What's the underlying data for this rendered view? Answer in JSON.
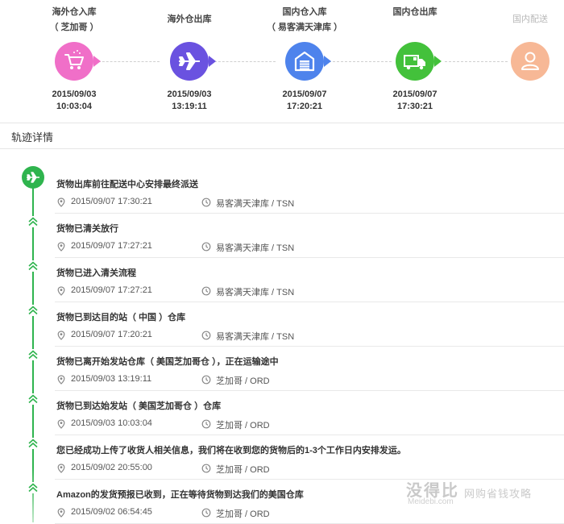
{
  "progress": {
    "steps": [
      {
        "label1": "海外仓入库",
        "label2": "（ 芝加哥 ）",
        "date": "2015/09/03",
        "time": "10:03:04",
        "color": "#f06fc8",
        "icon": "cart-icon"
      },
      {
        "label1": "海外仓出库",
        "label2": "",
        "date": "2015/09/03",
        "time": "13:19:11",
        "color": "#6a52e0",
        "icon": "airplane-icon"
      },
      {
        "label1": "国内仓入库",
        "label2": "（ 易客满天津库 ）",
        "date": "2015/09/07",
        "time": "17:20:21",
        "color": "#4e83ec",
        "icon": "warehouse-icon"
      },
      {
        "label1": "国内仓出库",
        "label2": "",
        "date": "2015/09/07",
        "time": "17:30:21",
        "color": "#43c13b",
        "icon": "truck-icon"
      },
      {
        "label1": "国内配送",
        "label2": "",
        "date": "",
        "time": "",
        "color": "#f7b896",
        "icon": "user-icon"
      }
    ]
  },
  "tracking": {
    "title": "轨迹详情",
    "accent": "#2fb44e",
    "entries": [
      {
        "msg": "货物出库前往配送中心安排最终派送",
        "time": "2015/09/07 17:30:21",
        "loc": "易客满天津库 / TSN"
      },
      {
        "msg": "货物已清关放行",
        "time": "2015/09/07 17:27:21",
        "loc": "易客满天津库 / TSN"
      },
      {
        "msg": "货物已进入清关流程",
        "time": "2015/09/07 17:27:21",
        "loc": "易客满天津库 / TSN"
      },
      {
        "msg": "货物已到达目的站（ 中国 ）仓库",
        "time": "2015/09/07 17:20:21",
        "loc": "易客满天津库 / TSN"
      },
      {
        "msg": "货物已离开始发站仓库（ 美国芝加哥仓 ），正在运输途中",
        "time": "2015/09/03 13:19:11",
        "loc": "芝加哥 / ORD"
      },
      {
        "msg": "货物已到达始发站（ 美国芝加哥仓 ）仓库",
        "time": "2015/09/03 10:03:04",
        "loc": "芝加哥 / ORD"
      },
      {
        "msg": "您已经成功上传了收货人相关信息，我们将在收到您的货物后的1-3个工作日内安排发运。",
        "time": "2015/09/02 20:55:00",
        "loc": "芝加哥 / ORD"
      },
      {
        "msg": "Amazon的发货预报已收到，正在等待货物到达我们的美国仓库",
        "time": "2015/09/02 06:54:45",
        "loc": "芝加哥 / ORD"
      }
    ]
  },
  "watermark": {
    "brand": "没得比",
    "site": "Meidebi.com",
    "slogan": "网购省钱攻略"
  }
}
